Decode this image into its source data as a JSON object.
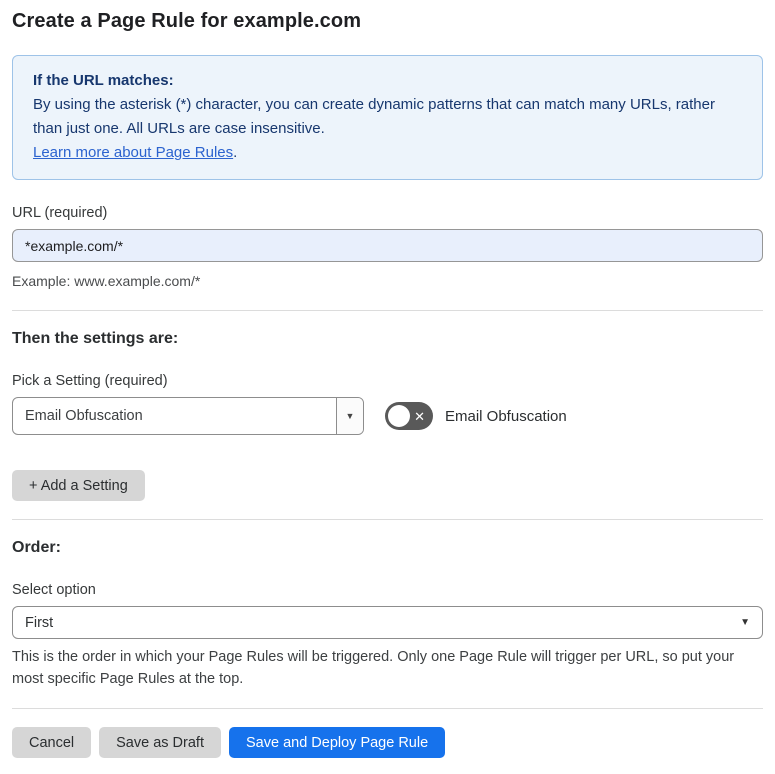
{
  "page": {
    "title": "Create a Page Rule for example.com"
  },
  "info_box": {
    "heading": "If the URL matches:",
    "body": "By using the asterisk (*) character, you can create dynamic patterns that can match many URLs, rather than just one. All URLs are case insensitive.",
    "link": "Learn more about Page Rules",
    "link_suffix": "."
  },
  "url_field": {
    "label": "URL (required)",
    "value": "*example.com/*",
    "example": "Example: www.example.com/*"
  },
  "settings": {
    "heading": "Then the settings are:",
    "picker_label": "Pick a Setting (required)",
    "picker_value": "Email Obfuscation",
    "picker_caret": "▼",
    "toggle_state": "off",
    "toggle_icon": "✕",
    "toggle_label": "Email Obfuscation",
    "add_button": "+ Add a Setting"
  },
  "order": {
    "heading": "Order:",
    "select_label": "Select option",
    "select_value": "First",
    "select_caret": "▼",
    "help": "This is the order in which your Page Rules will be triggered. Only one Page Rule will trigger per URL, so put your most specific Page Rules at the top."
  },
  "footer": {
    "cancel": "Cancel",
    "save_draft": "Save as Draft",
    "save_deploy": "Save and Deploy Page Rule"
  },
  "colors": {
    "accent_blue": "#1672ec",
    "info_bg": "#edf4fb",
    "info_border": "#9ec3e8",
    "info_text": "#17376e",
    "link_blue": "#2c63cf",
    "input_bg": "#e8effc",
    "toggle_off": "#595959",
    "button_gray": "#d6d6d6"
  }
}
